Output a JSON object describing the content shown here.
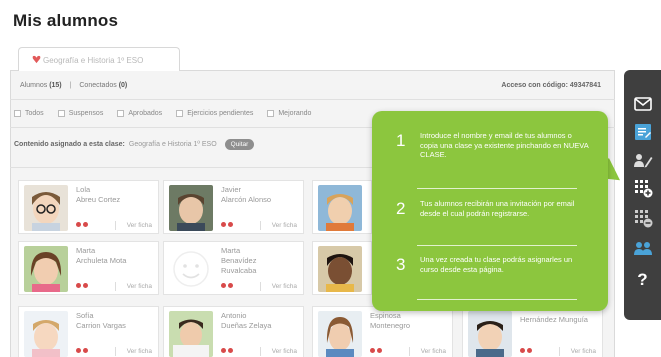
{
  "page": {
    "title": "Mis alumnos"
  },
  "tab": {
    "label": "Geografía e Historia 1º ESO"
  },
  "stats": {
    "students_label": "Alumnos",
    "students_count": "(15)",
    "separator": "|",
    "connected_label": "Conectados",
    "connected_count": "(0)",
    "access_code": "Acceso con código: 49347841"
  },
  "filters": [
    "Todos",
    "Suspensos",
    "Aprobados",
    "Ejercicios pendientes",
    "Mejorando"
  ],
  "content": {
    "label": "Contenido asignado a esta clase:",
    "class_name": "Geografía e Historia 1º ESO",
    "remove_label": "Quitar"
  },
  "students": [
    {
      "first": "Lola",
      "last": "Abreu Cortez",
      "ficha": "Ver ficha"
    },
    {
      "first": "Javier",
      "last": "Alarcón Alonso",
      "ficha": "Ver ficha"
    },
    {
      "first": "",
      "last": "",
      "ficha": ""
    },
    {
      "first": "Marta",
      "last": "Archuleta Mota",
      "ficha": "Ver ficha"
    },
    {
      "first": "Marta",
      "last": "Benavídez",
      "last2": "Ruvalcaba",
      "ficha": "Ver ficha"
    },
    {
      "first": "",
      "last": "",
      "ficha": ""
    },
    {
      "first": "Sofía",
      "last": "Carrion Vargas",
      "ficha": "Ver ficha"
    },
    {
      "first": "Antonio",
      "last": "Dueñas Zelaya",
      "ficha": "Ver ficha"
    },
    {
      "first": "",
      "last": "Espinosa",
      "last2": "Montenegro",
      "ficha": "Ver ficha"
    },
    {
      "first": "",
      "last": "Hernández Munguía",
      "ficha": "Ver ficha"
    }
  ],
  "popup": {
    "steps": [
      {
        "num": "1",
        "text": "Introduce el nombre y email de tus alumnos o copia una clase ya existente pinchando en NUEVA CLASE."
      },
      {
        "num": "2",
        "text": "Tus alumnos recibirán una invitación por email desde el cual podrán registrarse."
      },
      {
        "num": "3",
        "text": "Una vez creada tu clase podrás asignarles un curso desde esta página."
      }
    ]
  },
  "toolbar": {
    "items": [
      "mail-icon",
      "edit-class-icon",
      "edit-users-icon",
      "add-students-icon",
      "remove-students-icon",
      "users-group-icon",
      "help-icon"
    ],
    "help_label": "?"
  },
  "colors": {
    "accent_green": "#8cc63e",
    "toolbar_bg": "#3f3f3f",
    "toolbar_icon_blue": "#4aa3d8",
    "status_red": "#d84a4a"
  }
}
